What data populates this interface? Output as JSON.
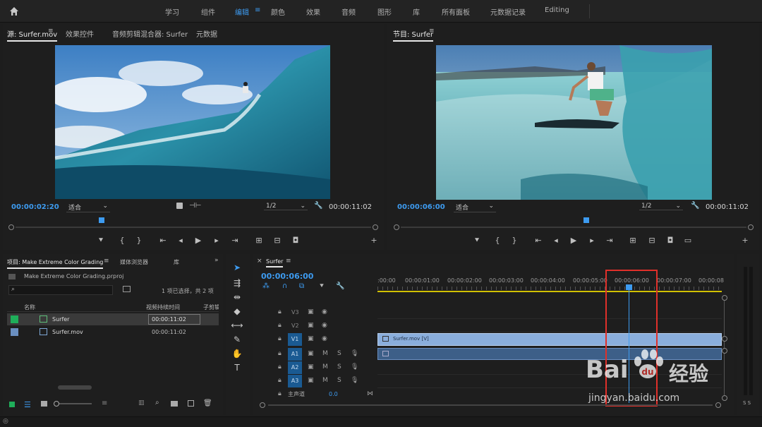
{
  "workspaces": [
    {
      "label": "学习"
    },
    {
      "label": "组件"
    },
    {
      "label": "编辑"
    },
    {
      "label": "颜色"
    },
    {
      "label": "效果"
    },
    {
      "label": "音频"
    },
    {
      "label": "图形"
    },
    {
      "label": "库"
    },
    {
      "label": "所有面板"
    },
    {
      "label": "元数据记录"
    },
    {
      "label": "Editing"
    }
  ],
  "active_workspace": "编辑",
  "source_monitor": {
    "tabs": [
      "源: Surfer.mov",
      "效果控件",
      "音频剪辑混合器: Surfer",
      "元数据"
    ],
    "timecode": "00:00:02:20",
    "fit": "适合",
    "resolution": "1/2",
    "duration": "00:00:11:02"
  },
  "program_monitor": {
    "title": "节目: Surfer",
    "timecode": "00:00:06:00",
    "fit": "适合",
    "resolution": "1/2",
    "duration": "00:00:11:02"
  },
  "project": {
    "tabs": [
      "项目: Make Extreme Color Grading",
      "媒体浏览器",
      "库"
    ],
    "file": "Make Extreme Color Grading.prproj",
    "selection_status": "1 项已选择，共 2 项",
    "columns": [
      "名称",
      "视频持续时间",
      "子剪辑"
    ],
    "items": [
      {
        "name": "Surfer",
        "duration": "00:00:11:02",
        "color": "#1fae5a"
      },
      {
        "name": "Surfer.mov",
        "duration": "00:00:11:02",
        "color": "#6a8fc0"
      }
    ]
  },
  "timeline": {
    "sequence": "Surfer",
    "timecode": "00:00:06:00",
    "ruler": [
      ":00:00",
      "00:00:01:00",
      "00:00:02:00",
      "00:00:03:00",
      "00:00:04:00",
      "00:00:05:00",
      "00:00:06:00",
      "00:00:07:00",
      "00:00:08"
    ],
    "tracks": [
      {
        "name": "V3",
        "type": "video"
      },
      {
        "name": "V2",
        "type": "video"
      },
      {
        "name": "V1",
        "type": "video",
        "active": true
      },
      {
        "name": "A1",
        "type": "audio",
        "active": true
      },
      {
        "name": "A2",
        "type": "audio",
        "active": true
      },
      {
        "name": "A3",
        "type": "audio",
        "active": true
      }
    ],
    "master_label": "主声道",
    "master_value": "0.0",
    "clip_label": "Surfer.mov [V]"
  },
  "meter": {
    "labels": "S S"
  },
  "watermark": {
    "brand": "Bai",
    "brand2": "经验",
    "url": "jingyan.baidu.com"
  },
  "colors": {
    "accent": "#3d9bf0",
    "highlight_box": "#e0302a",
    "clip": "#8aaedc"
  }
}
